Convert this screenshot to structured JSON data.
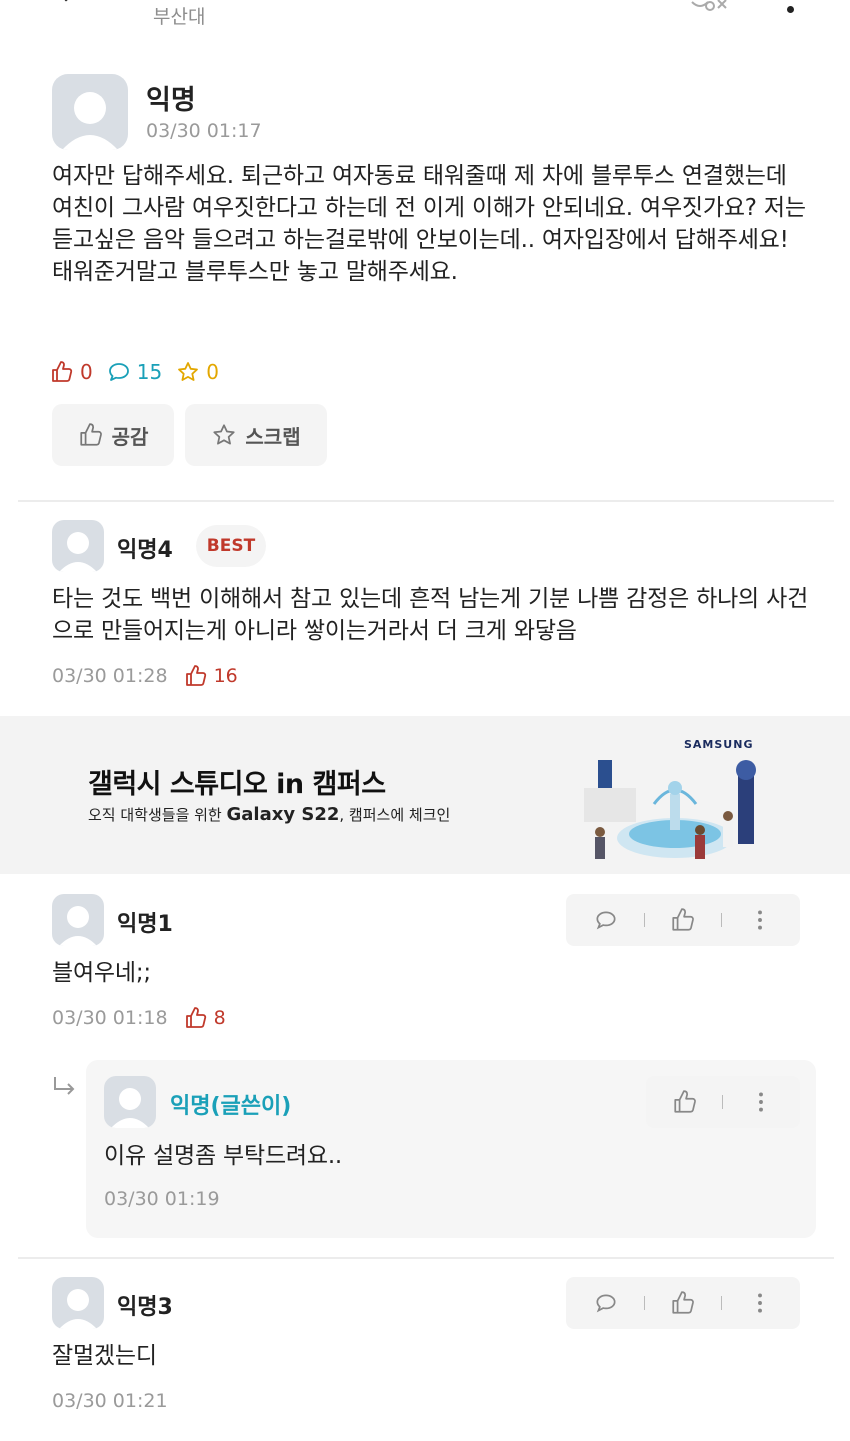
{
  "header": {
    "board_name": "부산대"
  },
  "post": {
    "author": "익명",
    "time": "03/30 01:17",
    "body": "여자만 답해주세요. 퇴근하고 여자동료 태워줄때 제 차에 블루투스 연결했는데 여친이 그사람 여우짓한다고 하는데 전 이게 이해가 안되네요. 여우짓가요? 저는 듣고싶은 음악 들으려고 하는걸로밖에 안보이는데.. 여자입장에서 답해주세요! 태워준거말고 블루투스만 놓고 말해주세요.",
    "like_count": "0",
    "comment_count": "15",
    "scrap_count": "0",
    "like_button": "공감",
    "scrap_button": "스크랩"
  },
  "best_comment": {
    "author": "익명4",
    "badge": "BEST",
    "body": "타는 것도 백번 이해해서 참고 있는데 흔적 남는게 기분 나쁨 감정은 하나의 사건으로 만들어지는게 아니라 쌓이는거라서 더 크게 와닿음",
    "time": "03/30 01:28",
    "likes": "16"
  },
  "ad": {
    "title": "갤럭시 스튜디오 in 캠퍼스",
    "subtitle_prefix": "오직 대학생들을 위한 ",
    "subtitle_product": "Galaxy S22",
    "subtitle_suffix": ", 캠퍼스에 체크인",
    "brand": "SAMSUNG"
  },
  "comments": [
    {
      "author": "익명1",
      "body": "블여우네;;",
      "time": "03/30 01:18",
      "likes": "8"
    },
    {
      "author": "익명3",
      "body": "잘멀겠는디",
      "time": "03/30 01:21"
    }
  ],
  "reply": {
    "author": "익명(글쓴이)",
    "body": "이유 설명좀 부탁드려요..",
    "time": "03/30 01:19"
  },
  "colors": {
    "like": "#c0392b",
    "comment": "#1aa0b8",
    "scrap": "#e3a700",
    "writer": "#1aa0b8"
  }
}
